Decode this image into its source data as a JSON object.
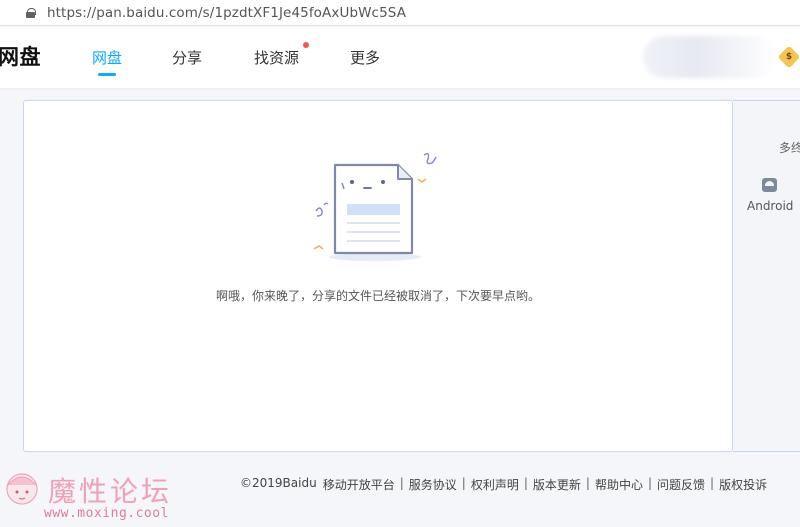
{
  "browser": {
    "url": "https://pan.baidu.com/s/1pzdtXF1Je45foAxUbWc5SA"
  },
  "header": {
    "logo": "网盘",
    "nav": [
      {
        "label": "网盘",
        "active": true
      },
      {
        "label": "分享",
        "active": false
      },
      {
        "label": "找资源",
        "active": false,
        "dot": true
      },
      {
        "label": "更多",
        "active": false
      }
    ],
    "vip_badge": "$"
  },
  "main": {
    "message": "啊哦，你来晚了，分享的文件已经被取消了，下次要早点哟。"
  },
  "side_panel": {
    "label": "多终",
    "android": "Android"
  },
  "footer": {
    "copyright": "©2019Baidu",
    "links": [
      "移动开放平台",
      "服务协议",
      "权利声明",
      "版本更新",
      "帮助中心",
      "问题反馈",
      "版权投诉"
    ]
  },
  "watermark": {
    "title": "魔性论坛",
    "url": "www.moxing.cool"
  },
  "colors": {
    "accent": "#09aaff",
    "card_border": "#c9d6ef",
    "notify_dot": "#f5564a"
  }
}
